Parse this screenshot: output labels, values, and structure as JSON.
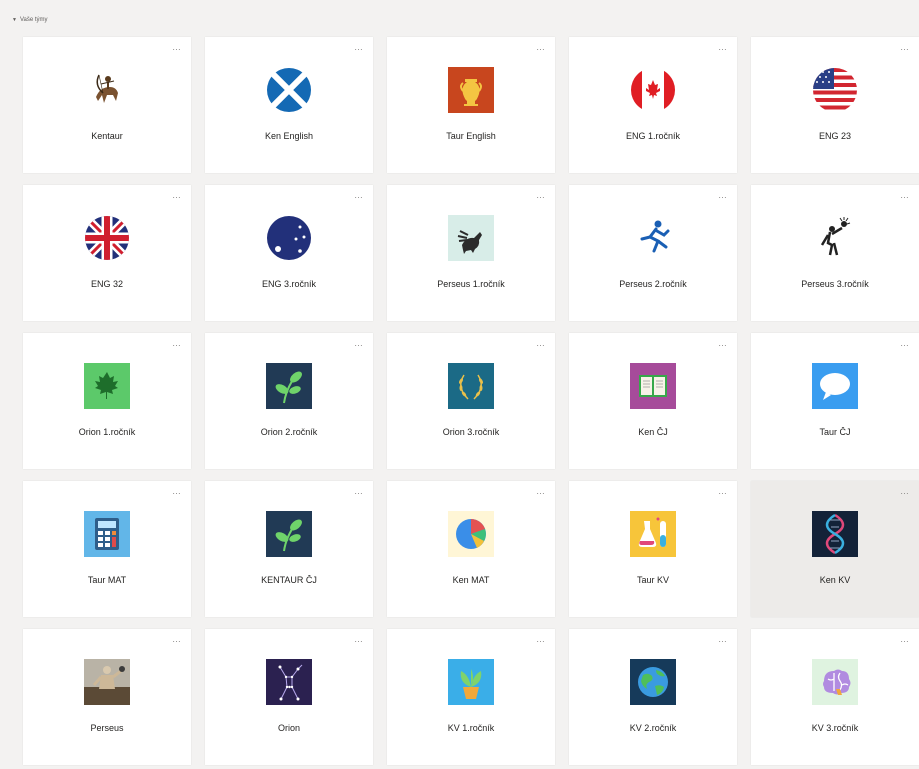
{
  "section": {
    "label": "Vaše týmy"
  },
  "teams": [
    {
      "name": "Kentaur",
      "icon": "centaur-archer-icon"
    },
    {
      "name": "Ken English",
      "icon": "scotland-flag-icon"
    },
    {
      "name": "Taur English",
      "icon": "amphora-icon"
    },
    {
      "name": "ENG 1.ročník",
      "icon": "canada-flag-icon"
    },
    {
      "name": "ENG 23",
      "icon": "usa-flag-icon"
    },
    {
      "name": "ENG 32",
      "icon": "uk-flag-icon"
    },
    {
      "name": "ENG 3.ročník",
      "icon": "australia-flag-icon"
    },
    {
      "name": "Perseus 1.ročník",
      "icon": "pegasus-icon"
    },
    {
      "name": "Perseus 2.ročník",
      "icon": "running-figure-icon"
    },
    {
      "name": "Perseus 3.ročník",
      "icon": "warrior-with-head-icon"
    },
    {
      "name": "Orion 1.ročník",
      "icon": "maple-leaf-icon"
    },
    {
      "name": "Orion 2.ročník",
      "icon": "sprout-icon"
    },
    {
      "name": "Orion 3.ročník",
      "icon": "laurel-wreath-icon"
    },
    {
      "name": "Ken ČJ",
      "icon": "open-book-icon"
    },
    {
      "name": "Taur ČJ",
      "icon": "speech-bubble-icon"
    },
    {
      "name": "Taur MAT",
      "icon": "calculator-icon"
    },
    {
      "name": "KENTAUR ČJ",
      "icon": "sprout-icon"
    },
    {
      "name": "Ken MAT",
      "icon": "pie-chart-icon"
    },
    {
      "name": "Taur KV",
      "icon": "lab-flasks-icon"
    },
    {
      "name": "Ken KV",
      "icon": "dna-icon",
      "selected": true
    },
    {
      "name": "Perseus",
      "icon": "perseus-statue-icon"
    },
    {
      "name": "Orion",
      "icon": "orion-constellation-icon"
    },
    {
      "name": "KV 1.ročník",
      "icon": "potted-plant-icon"
    },
    {
      "name": "KV 2.ročník",
      "icon": "earth-globe-icon"
    },
    {
      "name": "KV 3.ročník",
      "icon": "brain-icon"
    }
  ],
  "colors": {
    "background": "#f3f2f1",
    "card": "#ffffff",
    "card_selected": "#edebe9",
    "text": "#252423",
    "muted": "#8a8886"
  }
}
